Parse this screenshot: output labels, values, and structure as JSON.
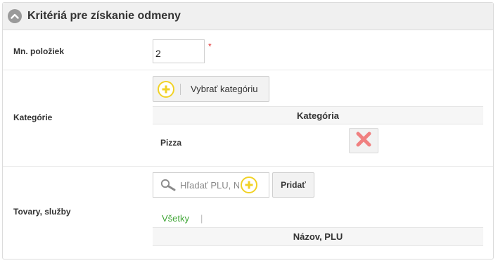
{
  "panel": {
    "title": "Kritériá pre získanie odmeny",
    "collapse_icon": "chevron-up-icon"
  },
  "quantity": {
    "label": "Mn. položiek",
    "value": "2",
    "required_mark": "*"
  },
  "categories": {
    "label": "Kategórie",
    "select_button_label": "Vybrať kategóriu",
    "column_header": "Kategória",
    "rows": [
      {
        "name": "Pizza",
        "delete_icon": "close-icon"
      }
    ]
  },
  "products": {
    "label": "Tovary, služby",
    "search_placeholder": "Hľadať PLU, N",
    "add_button_label": "Pridať",
    "filter_all_label": "Všetky",
    "filter_separator": "|",
    "column_header": "Názov, PLU"
  },
  "colors": {
    "accent_green": "#3fa535",
    "plus_yellow": "#f1d226",
    "delete_red": "#f08080",
    "required_red": "#e03030"
  }
}
